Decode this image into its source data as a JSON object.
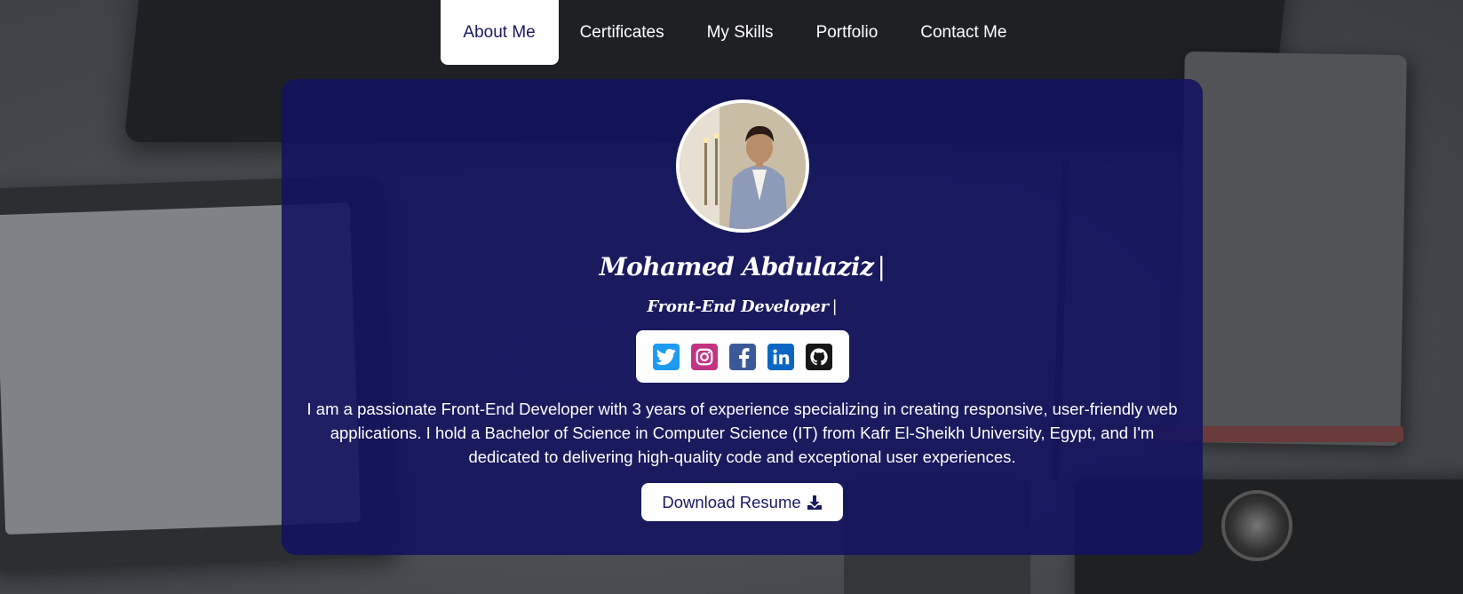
{
  "nav": {
    "items": [
      {
        "label": "About Me",
        "active": true
      },
      {
        "label": "Certificates",
        "active": false
      },
      {
        "label": "My Skills",
        "active": false
      },
      {
        "label": "Portfolio",
        "active": false
      },
      {
        "label": "Contact Me",
        "active": false
      }
    ]
  },
  "profile": {
    "name": "Mohamed Abdulaziz",
    "name_cursor": "|",
    "role": "Front-End Developer",
    "role_cursor": "|",
    "bio": "I am a passionate Front-End Developer with 3 years of experience specializing in creating responsive, user-friendly web applications. I hold a Bachelor of Science in Computer Science (IT) from Kafr El-Sheikh University, Egypt, and I'm dedicated to delivering high-quality code and exceptional user experiences.",
    "resume_button": "Download Resume",
    "resume_icon": "download-icon"
  },
  "socials": [
    {
      "icon": "twitter-icon",
      "color": "#1d9bf0"
    },
    {
      "icon": "instagram-icon",
      "color": "#c13584"
    },
    {
      "icon": "facebook-icon",
      "color": "#3b5998"
    },
    {
      "icon": "linkedin-icon",
      "color": "#0a66c2"
    },
    {
      "icon": "github-icon",
      "color": "#181717"
    }
  ],
  "colors": {
    "card_bg": "#121260",
    "accent_text": "#1a1763",
    "nav_text": "#ffffff"
  }
}
